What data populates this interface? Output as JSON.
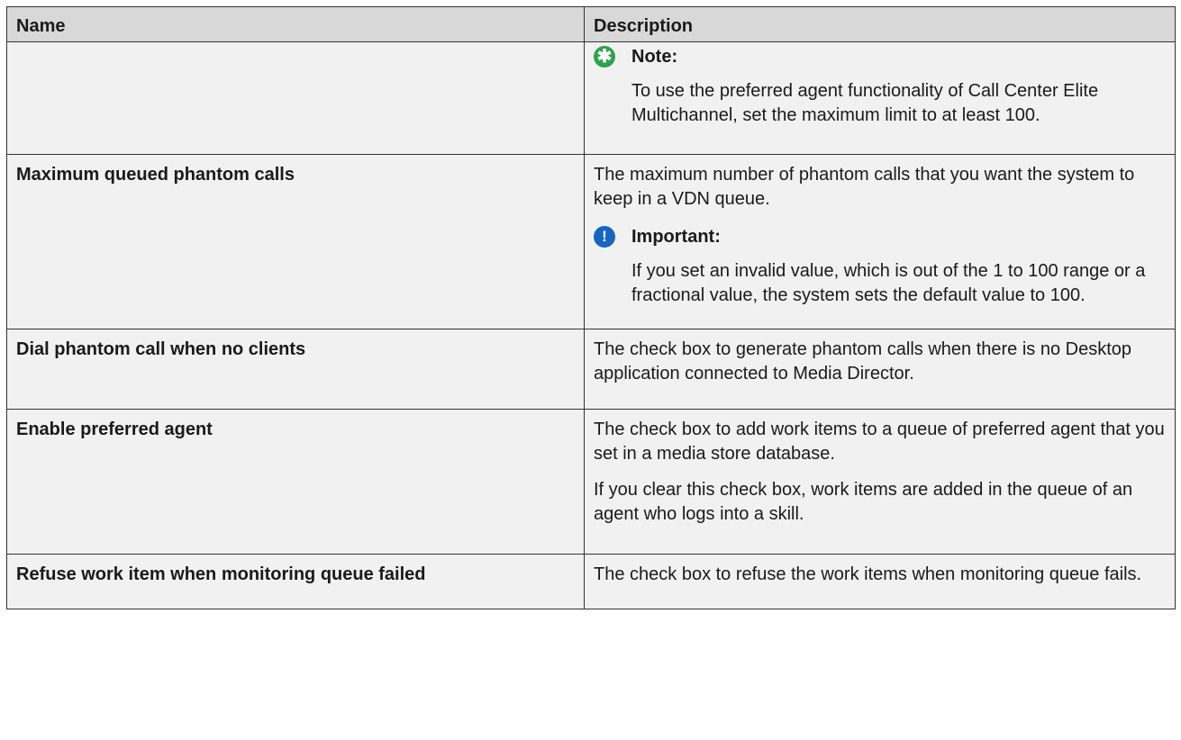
{
  "table": {
    "headers": [
      "Name",
      "Description"
    ],
    "rows": [
      {
        "name": "",
        "blocks": [
          {
            "type": "note",
            "label": "Note:",
            "text": "To use the preferred agent functionality of Call Center Elite Multichannel, set the maximum limit to at least 100."
          }
        ]
      },
      {
        "name": "Maximum queued phantom calls",
        "blocks": [
          {
            "type": "para",
            "text": "The maximum number of phantom calls that you want the system to keep in a VDN queue."
          },
          {
            "type": "important",
            "label": "Important:",
            "text": "If you set an invalid value, which is out of the 1 to 100 range or a fractional value, the system sets the default value to 100."
          }
        ]
      },
      {
        "name": "Dial phantom call when no clients",
        "blocks": [
          {
            "type": "para",
            "text": "The check box to generate phantom calls when there is no Desktop application connected to Media Director."
          }
        ]
      },
      {
        "name": "Enable preferred agent",
        "blocks": [
          {
            "type": "para",
            "text": "The check box to add work items to a queue of preferred agent that you set in a media store database."
          },
          {
            "type": "para",
            "text": "If you clear this check box, work items are added in the queue of an agent who logs into a skill."
          }
        ]
      },
      {
        "name": "Refuse work item when monitoring queue failed",
        "blocks": [
          {
            "type": "para",
            "text": "The check box to refuse the work items when monitoring queue fails."
          }
        ]
      }
    ]
  },
  "icons": {
    "note": "note-star-icon",
    "important": "important-exclamation-icon"
  },
  "colors": {
    "header_bg": "#d8d8d8",
    "cell_bg": "#f1f1f1",
    "note_icon": "#2ca24a",
    "important_icon": "#1665c0"
  }
}
